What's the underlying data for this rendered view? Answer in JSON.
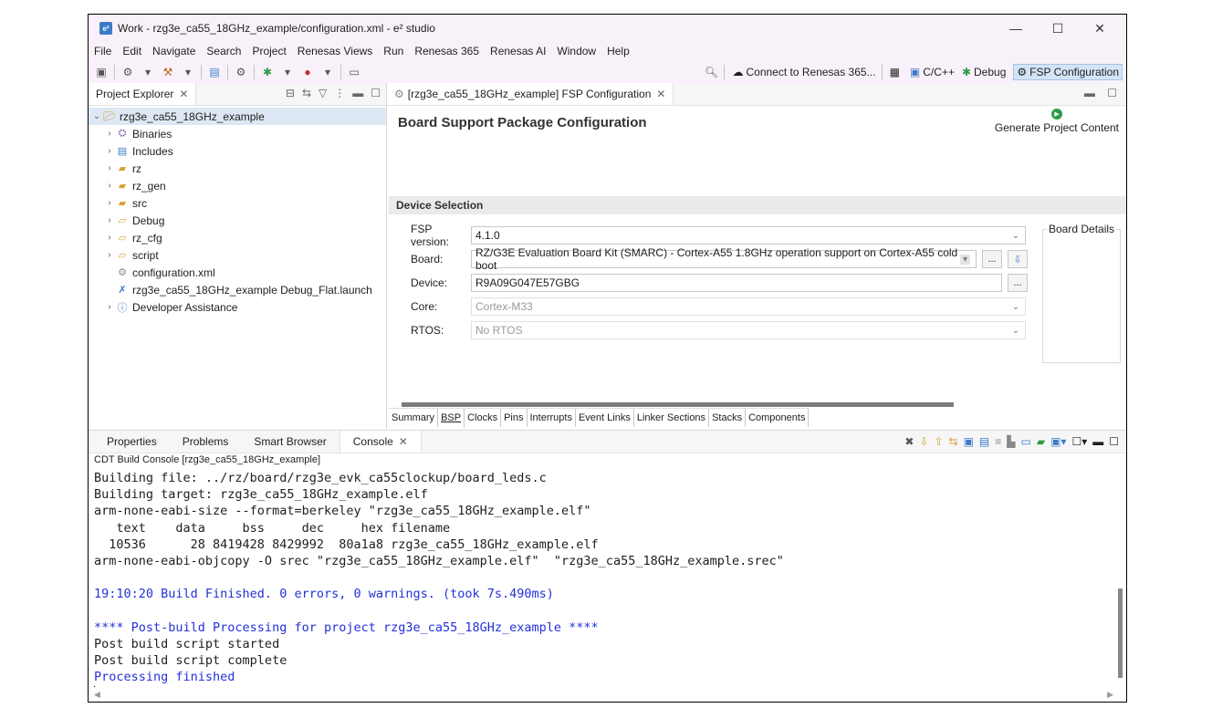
{
  "window": {
    "title": "Work - rzg3e_ca55_18GHz_example/configuration.xml - e² studio",
    "minimize": "—",
    "maximize": "☐",
    "close": "✕"
  },
  "menu": [
    "File",
    "Edit",
    "Navigate",
    "Search",
    "Project",
    "Renesas Views",
    "Run",
    "Renesas 365",
    "Renesas AI",
    "Window",
    "Help"
  ],
  "toolbar": {
    "connect_label": "Connect to Renesas 365...",
    "perspectives": [
      "C/C++",
      "Debug",
      "FSP Configuration"
    ]
  },
  "project_explorer": {
    "tab_label": "Project Explorer",
    "items": [
      {
        "label": "rzg3e_ca55_18GHz_example",
        "icon": "project-icon",
        "expanded": true
      },
      {
        "label": "Binaries",
        "icon": "binaries-icon"
      },
      {
        "label": "Includes",
        "icon": "includes-icon"
      },
      {
        "label": "rz",
        "icon": "source-folder-icon"
      },
      {
        "label": "rz_gen",
        "icon": "source-folder-icon"
      },
      {
        "label": "src",
        "icon": "source-folder-icon"
      },
      {
        "label": "Debug",
        "icon": "folder-icon"
      },
      {
        "label": "rz_cfg",
        "icon": "folder-icon"
      },
      {
        "label": "script",
        "icon": "folder-icon"
      },
      {
        "label": "configuration.xml",
        "icon": "gear-file-icon"
      },
      {
        "label": "rzg3e_ca55_18GHz_example Debug_Flat.launch",
        "icon": "launch-file-icon"
      },
      {
        "label": "Developer Assistance",
        "icon": "help-icon"
      }
    ]
  },
  "editor": {
    "tab_label": "[rzg3e_ca55_18GHz_example] FSP Configuration",
    "title": "Board Support Package Configuration",
    "generate_label": "Generate Project Content",
    "section_title": "Device Selection",
    "fsp_version_label": "FSP version:",
    "fsp_version_value": "4.1.0",
    "board_label": "Board:",
    "board_value": "RZ/G3E Evaluation Board Kit (SMARC) - Cortex-A55 1.8GHz operation support on Cortex-A55 cold boot",
    "device_label": "Device:",
    "device_value": "R9A09G047E57GBG",
    "core_label": "Core:",
    "core_value": "Cortex-M33",
    "rtos_label": "RTOS:",
    "rtos_value": "No RTOS",
    "browse_label": "...",
    "board_details_label": "Board Details",
    "bottom_tabs": [
      "Summary",
      "BSP",
      "Clocks",
      "Pins",
      "Interrupts",
      "Event Links",
      "Linker Sections",
      "Stacks",
      "Components"
    ],
    "active_bottom_tab": "BSP"
  },
  "bottom_panel": {
    "tabs": [
      "Properties",
      "Problems",
      "Smart Browser",
      "Console"
    ],
    "active_tab": "Console",
    "console_label": "CDT Build Console [rzg3e_ca55_18GHz_example]",
    "lines": [
      {
        "text": "Building file: ../rz/board/rzg3e_evk_ca55clockup/board_leds.c",
        "color": "#1e1e1e"
      },
      {
        "text": "Building target: rzg3e_ca55_18GHz_example.elf",
        "color": "#1e1e1e"
      },
      {
        "text": "arm-none-eabi-size --format=berkeley \"rzg3e_ca55_18GHz_example.elf\"",
        "color": "#1e1e1e"
      },
      {
        "text": "   text    data     bss     dec     hex filename",
        "color": "#1e1e1e"
      },
      {
        "text": "  10536      28 8419428 8429992  80a1a8 rzg3e_ca55_18GHz_example.elf",
        "color": "#1e1e1e"
      },
      {
        "text": "arm-none-eabi-objcopy -O srec \"rzg3e_ca55_18GHz_example.elf\"  \"rzg3e_ca55_18GHz_example.srec\"",
        "color": "#1e1e1e"
      },
      {
        "text": "",
        "color": "#1e1e1e"
      },
      {
        "text": "19:10:20 Build Finished. 0 errors, 0 warnings. (took 7s.490ms)",
        "color": "#2331d8"
      },
      {
        "text": "",
        "color": "#1e1e1e"
      },
      {
        "text": "**** Post-build Processing for project rzg3e_ca55_18GHz_example ****",
        "color": "#2331d8"
      },
      {
        "text": "Post build script started",
        "color": "#1e1e1e"
      },
      {
        "text": "Post build script complete",
        "color": "#1e1e1e"
      },
      {
        "text": "Processing finished",
        "color": "#2331d8"
      }
    ]
  }
}
